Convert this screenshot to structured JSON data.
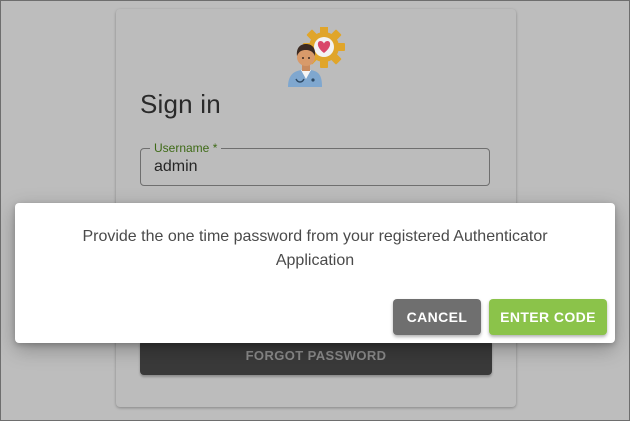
{
  "login": {
    "title": "Sign in",
    "username": {
      "label": "Username *",
      "value": "admin"
    },
    "forgot_password_label": "FORGOT PASSWORD",
    "logo_icon": "doctor-with-heart-gear-logo"
  },
  "dialog": {
    "message": "Provide the one time password from your registered Authenticator Application",
    "cancel_label": "CANCEL",
    "enter_code_label": "ENTER CODE"
  },
  "colors": {
    "accent_green": "#8bc34a",
    "cancel_grey": "#6f6f6f",
    "label_green": "#3e6a16",
    "backdrop": "#bdbdbd"
  }
}
